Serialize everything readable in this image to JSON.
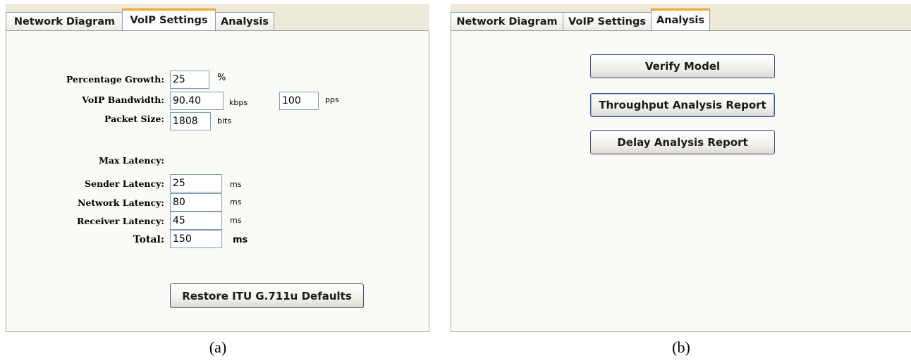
{
  "panel_a": {
    "tabs": [
      "Network Diagram",
      "VoIP Settings",
      "Analysis"
    ],
    "active_tab": "VoIP Settings",
    "fields": {
      "percentage_growth": {
        "label": "Percentage Growth:",
        "value": "25",
        "unit": "%"
      },
      "voip_bandwidth": {
        "label": "VoIP Bandwidth:",
        "value": "90.40",
        "unit": "kbps"
      },
      "pps": {
        "value": "100",
        "unit": "pps"
      },
      "packet_size": {
        "label": "Packet Size:",
        "value": "1808",
        "unit": "bits"
      },
      "max_latency_heading": "Max Latency:",
      "sender_latency": {
        "label": "Sender Latency:",
        "value": "25",
        "unit": "ms"
      },
      "network_latency": {
        "label": "Network Latency:",
        "value": "80",
        "unit": "ms"
      },
      "receiver_latency": {
        "label": "Receiver Latency:",
        "value": "45",
        "unit": "ms"
      },
      "total": {
        "label": "Total:",
        "value": "150",
        "unit": "ms"
      }
    },
    "restore_button": "Restore ITU G.711u Defaults"
  },
  "panel_b": {
    "tabs": [
      "Network Diagram",
      "VoIP Settings",
      "Analysis"
    ],
    "active_tab": "Analysis",
    "buttons": {
      "verify_model": "Verify Model",
      "throughput_report": "Throughput Analysis Report",
      "delay_report": "Delay Analysis Report"
    }
  },
  "captions": {
    "a": "(a)",
    "b": "(b)"
  },
  "colors": {
    "active_tab_accent": "#f0a830",
    "tab_strip": "#ece9d8",
    "button_border": "#3c4e83"
  }
}
